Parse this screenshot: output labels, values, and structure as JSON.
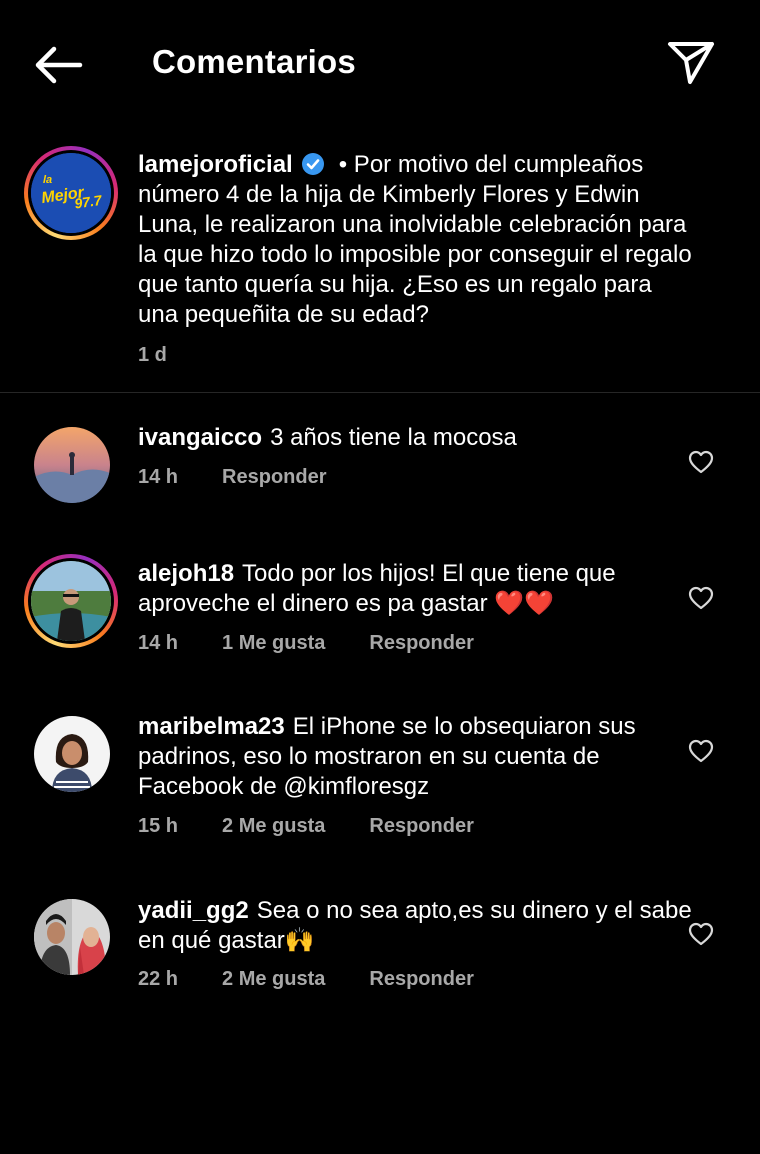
{
  "header": {
    "title": "Comentarios"
  },
  "caption": {
    "username": "lamejoroficial",
    "text": "• Por motivo del cumpleaños número 4 de la hija de Kimberly Flores y Edwin Luna, le realizaron una inolvidable celebración para la que hizo todo lo imposible por conseguir el regalo que tanto quería su hija. ¿Eso es un regalo para una pequeñita de su edad?",
    "time": "1 d",
    "logo_line1": "la",
    "logo_line2": "Mejor",
    "logo_line3": "97.7"
  },
  "comments": [
    {
      "username": "ivangaicco",
      "text": "3 años tiene la mocosa",
      "time": "14 h",
      "likes": "",
      "reply": "Responder"
    },
    {
      "username": "alejoh18",
      "text": "Todo por los hijos! El que tiene que aproveche el dinero es pa gastar ❤️❤️",
      "time": "14 h",
      "likes": "1 Me gusta",
      "reply": "Responder"
    },
    {
      "username": "maribelma23",
      "text": "El iPhone se lo obsequiaron sus padrinos, eso lo mostraron en su cuenta de Facebook de @kimfloresgz",
      "time": "15 h",
      "likes": "2 Me gusta",
      "reply": "Responder"
    },
    {
      "username": "yadii_gg2",
      "text": "Sea o no sea apto,es su dinero y el sabe en qué gastar🙌",
      "time": "22 h",
      "likes": "2 Me gusta",
      "reply": "Responder"
    }
  ],
  "icons": {
    "back": "arrow-left-icon",
    "send": "paper-plane-icon",
    "verified": "verified-badge-icon",
    "like": "heart-outline-icon"
  },
  "colors": {
    "background": "#000000",
    "secondary_text": "#a8a8a8",
    "verified": "#3897f0"
  }
}
